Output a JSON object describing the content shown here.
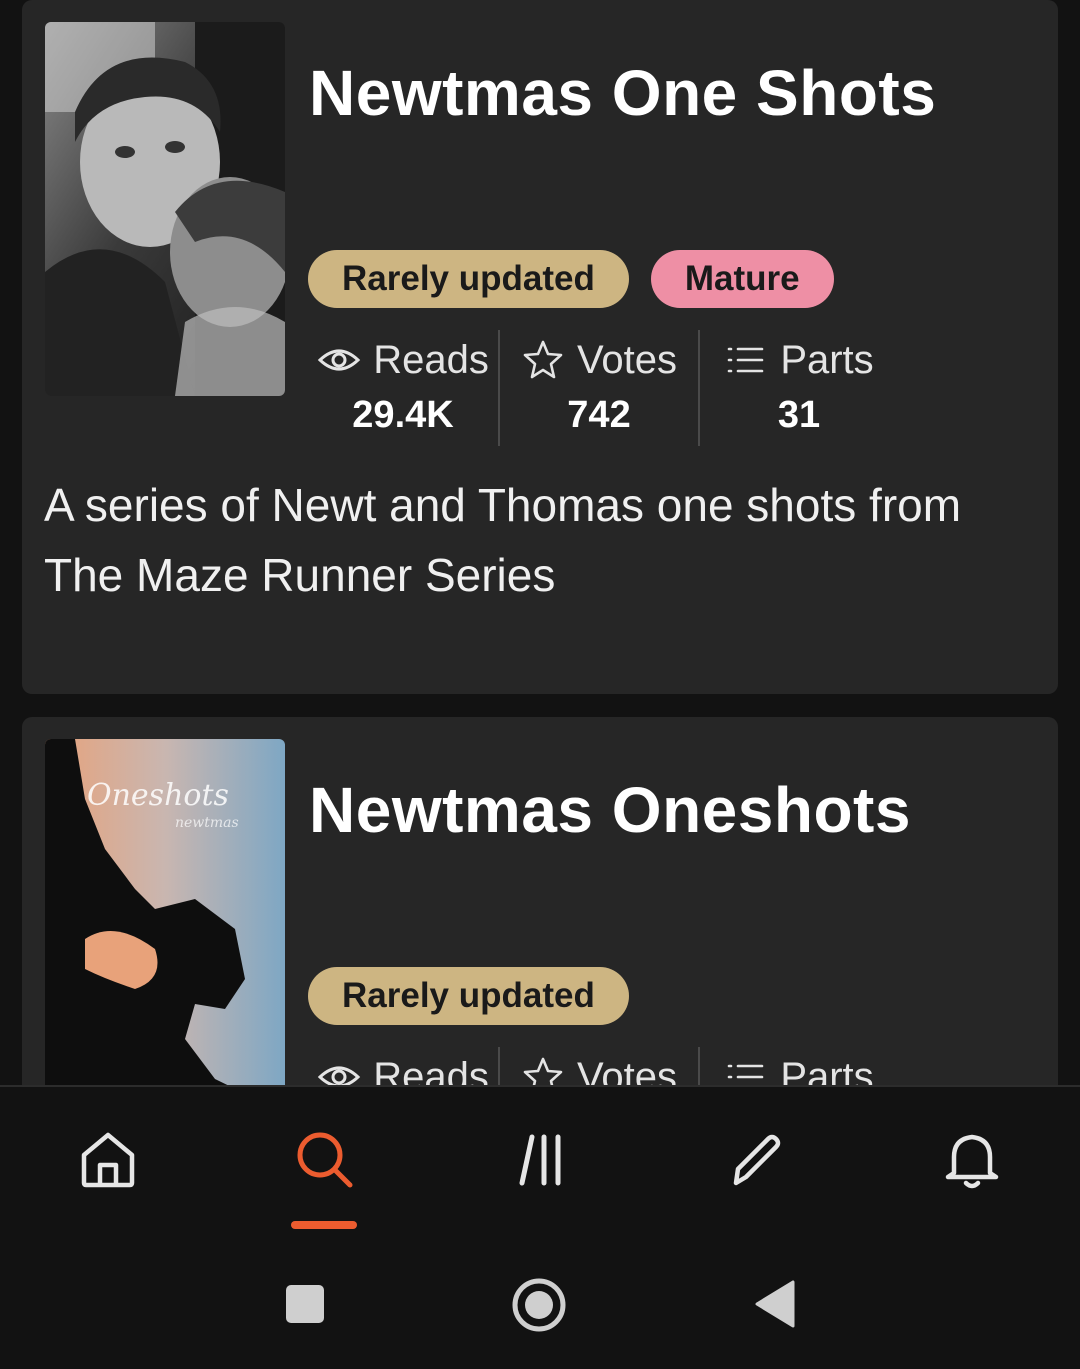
{
  "stories": [
    {
      "title": "Newtmas One Shots",
      "tags": [
        "Rarely updated",
        "Mature"
      ],
      "stats": {
        "reads_label": "Reads",
        "reads": "29.4K",
        "votes_label": "Votes",
        "votes": "742",
        "parts_label": "Parts",
        "parts": "31"
      },
      "description": "A series of Newt and Thomas one shots from The Maze Runner Series"
    },
    {
      "title": "Newtmas Oneshots",
      "cover_text": "Oneshots",
      "cover_subtext": "newtmas",
      "tags": [
        "Rarely updated"
      ],
      "stats": {
        "reads_label": "Reads",
        "votes_label": "Votes",
        "parts_label": "Parts"
      }
    }
  ],
  "nav": {
    "items": [
      "home-icon",
      "search-icon",
      "library-icon",
      "write-icon",
      "bell-icon"
    ],
    "active": "search-icon"
  },
  "colors": {
    "background": "#121212",
    "card": "#262626",
    "tag_rarely_updated": "#cdb582",
    "tag_mature": "#ee8fa5",
    "active_accent": "#ec5c2f"
  }
}
